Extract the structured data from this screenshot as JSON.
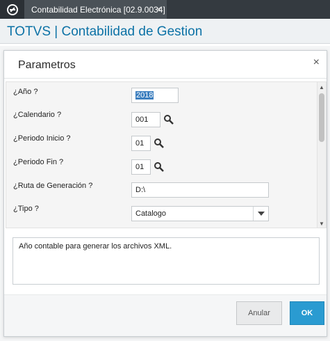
{
  "tab": {
    "title": "Contabilidad Electrónica [02.9.0034]",
    "close_glyph": "×"
  },
  "app": {
    "title": "TOTVS | Contabilidad de Gestion"
  },
  "dialog": {
    "title": "Parametros",
    "close_glyph": "×"
  },
  "fields": [
    {
      "label": "¿Año ?",
      "value": "2018"
    },
    {
      "label": "¿Calendario ?",
      "value": "001"
    },
    {
      "label": "¿Periodo Inicio ?",
      "value": "01"
    },
    {
      "label": "¿Periodo Fin ?",
      "value": "01"
    },
    {
      "label": "¿Ruta de Generación ?",
      "value": "D:\\"
    },
    {
      "label": "¿Tipo ?",
      "value": "Catalogo"
    }
  ],
  "help": {
    "text": "Año contable para generar los archivos XML."
  },
  "buttons": {
    "cancel": "Anular",
    "ok": "OK"
  },
  "colors": {
    "accent": "#2a9bd1",
    "title_blue": "#0c72a6"
  }
}
